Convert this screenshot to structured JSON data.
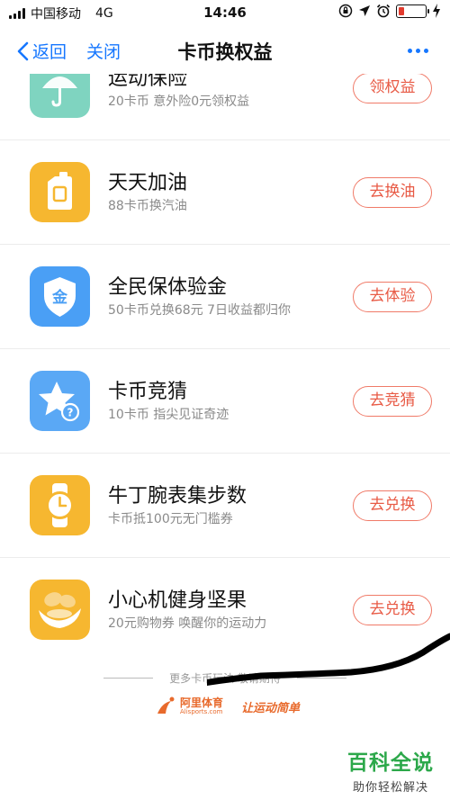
{
  "status_bar": {
    "carrier": "中国移动",
    "network": "4G",
    "time": "14:46"
  },
  "nav": {
    "back_label": "返回",
    "close_label": "关闭",
    "title": "卡币换权益"
  },
  "items": [
    {
      "title": "运动保险",
      "subtitle": "20卡币 意外险0元领权益",
      "button": "领权益",
      "icon": "umbrella-icon",
      "icon_color": "#7fd4c0"
    },
    {
      "title": "天天加油",
      "subtitle": "88卡币换汽油",
      "button": "去换油",
      "icon": "fuel-can-icon",
      "icon_color": "#f6b730"
    },
    {
      "title": "全民保体验金",
      "subtitle": "50卡币兑换68元 7日收益都归你",
      "button": "去体验",
      "icon": "shield-coin-icon",
      "icon_color": "#4a9ff5"
    },
    {
      "title": "卡币竞猜",
      "subtitle": "10卡币 指尖见证奇迹",
      "button": "去竞猜",
      "icon": "star-question-icon",
      "icon_color": "#5aa8f5"
    },
    {
      "title": "牛丁腕表集步数",
      "subtitle": "卡币抵100元无门槛券",
      "button": "去兑换",
      "icon": "watch-icon",
      "icon_color": "#f6b730"
    },
    {
      "title": "小心机健身坚果",
      "subtitle": "20元购物券 唤醒你的运动力",
      "button": "去兑换",
      "icon": "nuts-icon",
      "icon_color": "#f6b730"
    }
  ],
  "footer": {
    "more_text": "更多卡币玩法 敬请期待",
    "brand_name": "阿里体育",
    "brand_domain": "Alisports.com",
    "slogan": "让运动简单"
  },
  "watermark": {
    "title": "百科全说",
    "subtitle": "助你轻松解决"
  },
  "colors": {
    "accent_blue": "#1677ff",
    "button_red": "#e85a45",
    "watermark_green": "#2ca84a"
  }
}
